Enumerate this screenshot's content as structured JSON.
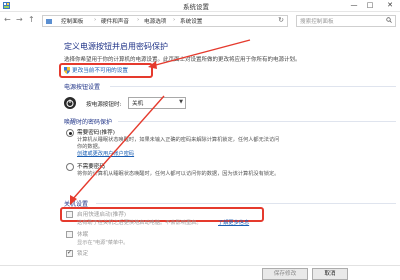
{
  "window": {
    "title": "系统设置",
    "minimize": "—",
    "maximize": "□",
    "close": "✕"
  },
  "nav": {
    "back": "←",
    "forward": "→",
    "up": "↑",
    "breadcrumb": [
      "控制面板",
      "硬件和声音",
      "电源选项",
      "系统设置"
    ],
    "refresh": "↻",
    "search_placeholder": "搜索控制面板"
  },
  "page": {
    "title": "定义电源按钮并启用密码保护",
    "description": "选择你希望用于你的计算机的电源设置。此页面上对设置所做的更改将应用于你所有的电源计划。",
    "change_link": "更改当前不可用的设置"
  },
  "power_button": {
    "section_title": "电源按钮设置",
    "label": "按电源按钮时:",
    "value": "关机"
  },
  "wake_password": {
    "section_title": "唤醒时的密码保护",
    "options": [
      {
        "label": "需要密码(推荐)",
        "selected": true,
        "desc1": "计算机从睡眠状态唤醒时，如果未输入正确的密码来解除计算机锁定，任何人都无法访问",
        "desc2": "你的数据。",
        "link": "创建或更改用户帐户密码"
      },
      {
        "label": "不需要密码",
        "selected": false,
        "desc1": "将你的计算机从睡眠状态唤醒时，任何人都可以访问你的数据，因为该计算机没有锁定。"
      }
    ]
  },
  "shutdown": {
    "section_title": "关机设置",
    "items": [
      {
        "label": "启用快速启动(推荐)",
        "checked": false,
        "desc": "这有助于在关机之后更快地启动电脑。不会影响重启。",
        "link": "了解更多信息"
      },
      {
        "label": "休眠",
        "checked": false,
        "desc": "显示在\"电源\"菜单中。"
      },
      {
        "label": "锁定",
        "checked": true
      }
    ]
  },
  "buttons": {
    "save": "保存修改",
    "cancel": "取消"
  },
  "colors": {
    "heading": "#1e3287",
    "link": "#1a5fb4",
    "annotation_red": "#e53a2d"
  }
}
